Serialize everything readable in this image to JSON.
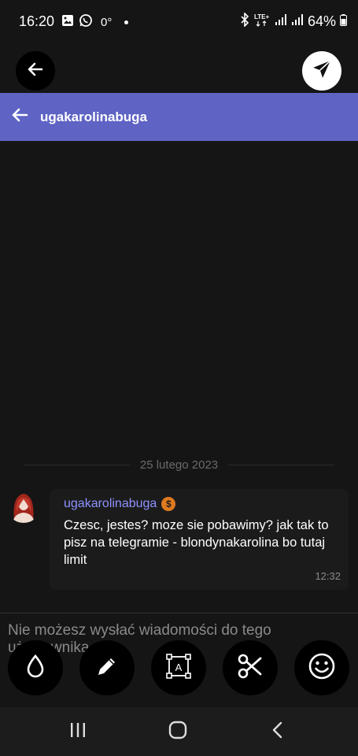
{
  "status_bar": {
    "time": "16:20",
    "temperature": "0°",
    "network": "LTE+",
    "battery": "64%"
  },
  "header": {
    "title": "ugakarolinabuga",
    "color": "#5e63c4"
  },
  "conversation": {
    "date_separator": "25 lutego 2023",
    "messages": [
      {
        "author": "ugakarolinabuga",
        "badge_icon": "dollar-badge-icon",
        "text": "Czesc, jestes? moze sie pobawimy? jak tak to pisz na telegramie - blondynakarolina bo tutaj limit",
        "time": "12:32"
      }
    ]
  },
  "input": {
    "notice": "Nie możesz wysłać wiadomości do tego użytkownika"
  },
  "edit_toolbar": {
    "tools": [
      "drop-icon",
      "pencil-icon",
      "text-select-icon",
      "scissors-icon",
      "smiley-icon"
    ]
  },
  "colors": {
    "accent": "#5e63c4",
    "author_name": "#8f92ff",
    "badge": "#e07a1f",
    "background": "#151515"
  }
}
